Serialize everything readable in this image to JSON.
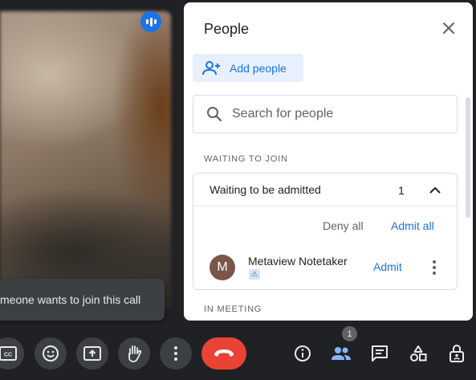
{
  "colors": {
    "background": "#202124",
    "accent": "#1a73e8",
    "end_call": "#ea4335",
    "panel": "#ffffff",
    "avatar": "#7a5548"
  },
  "toast": {
    "text": "meone wants to join this call"
  },
  "people_panel": {
    "title": "People",
    "add_people_label": "Add people",
    "search_placeholder": "Search for people",
    "waiting_section_label": "WAITING TO JOIN",
    "waiting_group": {
      "title": "Waiting to be admitted",
      "count": "1",
      "deny_all_label": "Deny all",
      "admit_all_label": "Admit all",
      "guests": [
        {
          "avatar_initial": "M",
          "name": "Metaview Notetaker",
          "warning_icon": "warning-triangle-icon",
          "admit_label": "Admit"
        }
      ]
    },
    "in_meeting_section_label": "IN MEETING"
  },
  "toolbar": {
    "left_buttons": [
      "closed-captions-icon",
      "emoji-icon",
      "present-screen-icon",
      "raise-hand-icon",
      "more-options-icon"
    ],
    "end_call_icon": "end-call-icon",
    "right_icons": [
      "info-icon",
      "people-icon",
      "chat-icon",
      "activities-icon",
      "host-controls-icon"
    ],
    "people_badge_count": "1"
  }
}
